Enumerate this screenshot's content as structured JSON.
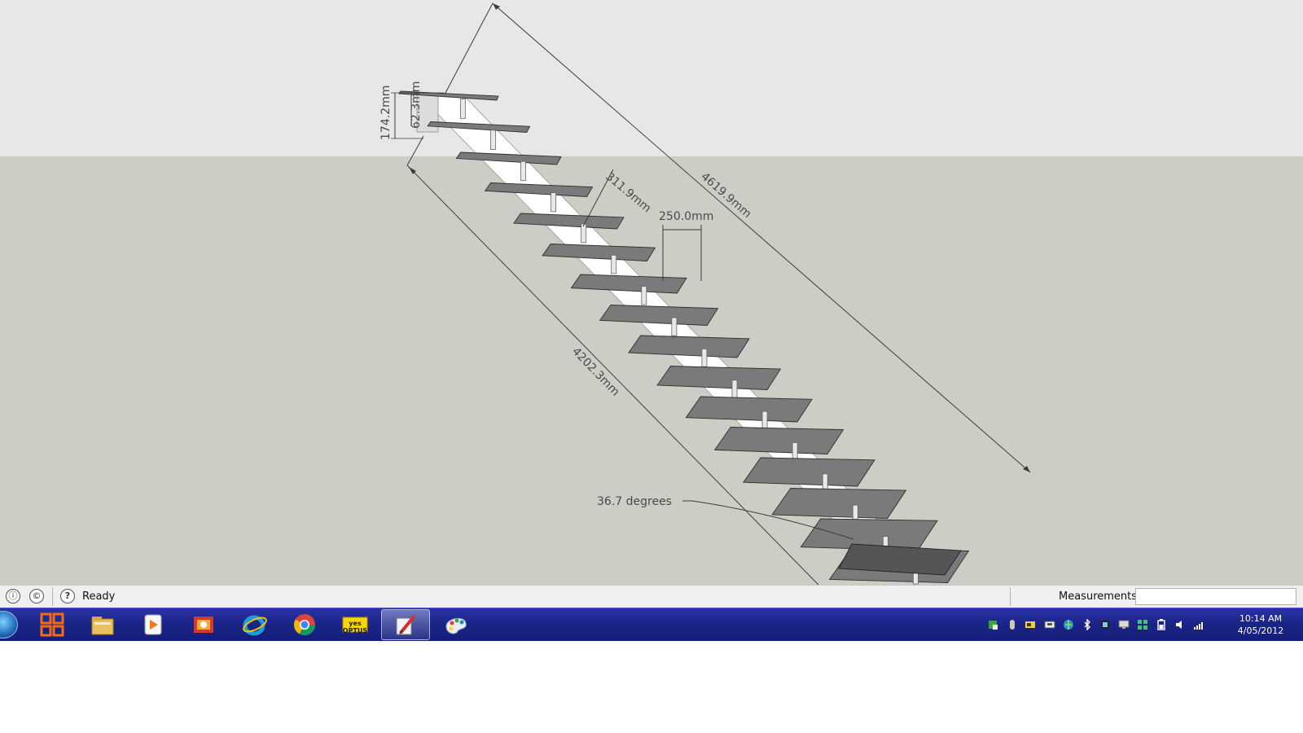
{
  "viewport": {
    "dimensions": {
      "riser_height": "174.2mm",
      "tread_thickness": "62.3mm",
      "tread_depth": "311.9mm",
      "going": "250.0mm",
      "overall_length": "4619.9mm",
      "stringer_length": "4202.3mm",
      "angle": "36.7 degrees"
    },
    "colors": {
      "sky": "#e5e7e7",
      "ground": "#ccccc5",
      "tread": "#7a7a7a",
      "stringer": "#ffffff",
      "dimension": "#404040"
    },
    "tread_count": 16
  },
  "statusbar": {
    "geo_icon": "geo-location-icon",
    "credits_icon": "credits-icon",
    "help_icon": "help-icon",
    "status": "Ready",
    "measurements_label": "Measurements",
    "measurements_value": ""
  },
  "taskbar": {
    "start_icon": "windows-start-orb",
    "pinned": [
      {
        "name": "microsoft-office-icon",
        "active": false
      },
      {
        "name": "file-explorer-icon",
        "active": false
      },
      {
        "name": "media-player-icon",
        "active": false
      },
      {
        "name": "control-panel-icon",
        "active": false
      },
      {
        "name": "internet-explorer-icon",
        "active": false
      },
      {
        "name": "chrome-icon",
        "active": false
      },
      {
        "name": "yes-optus-icon",
        "active": false,
        "label": "yes OPTUS"
      },
      {
        "name": "sketchup-icon",
        "active": true
      },
      {
        "name": "paint-icon",
        "active": false
      }
    ],
    "tray": [
      "flag-icon",
      "usb-icon",
      "battery-meter-icon",
      "keyboard-icon",
      "network-globe-icon",
      "bluetooth-icon",
      "device-icon",
      "monitor-icon",
      "app-grid-icon",
      "battery-icon",
      "volume-icon",
      "signal-icon"
    ],
    "clock": {
      "time": "10:14 AM",
      "date": "4/05/2012"
    }
  }
}
